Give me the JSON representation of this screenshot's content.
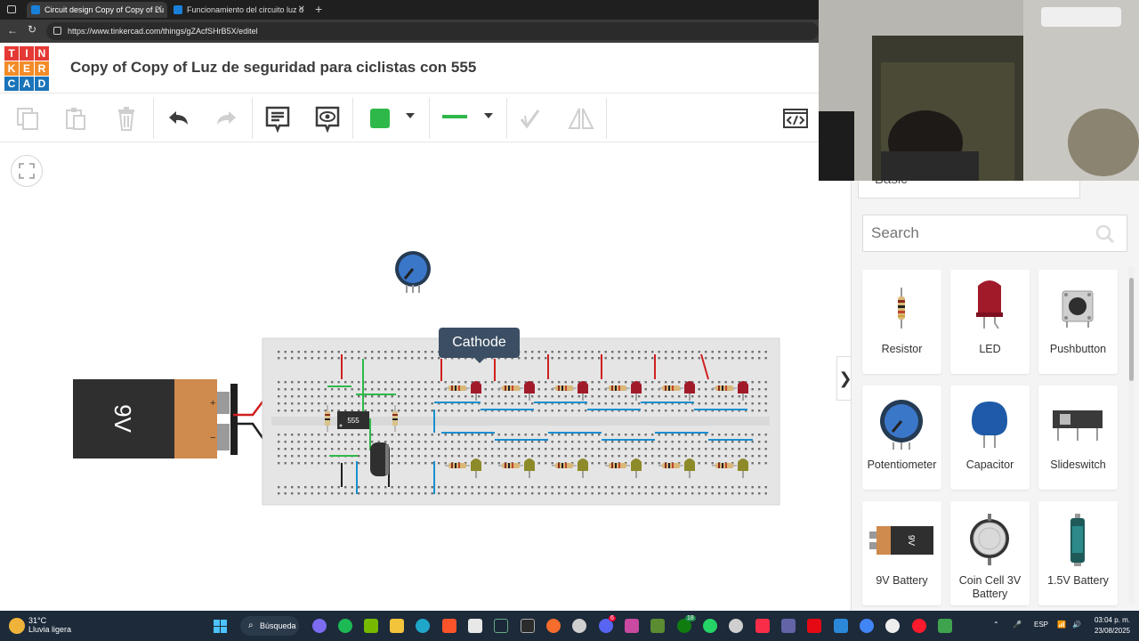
{
  "browser": {
    "tabs": [
      {
        "title": "Circuit design Copy of Copy of Lu"
      },
      {
        "title": "Funcionamiento del circuito luz d"
      }
    ],
    "url": "https://www.tinkercad.com/things/gZAcfSHrB5X/editel"
  },
  "app": {
    "logo_letters": [
      "T",
      "I",
      "N",
      "K",
      "E",
      "R",
      "C",
      "A",
      "D"
    ],
    "title": "Copy of Copy of Luz de seguridad para ciclistas con 555"
  },
  "canvas": {
    "tooltip": "Cathode",
    "battery_label": "9V",
    "ic_label": "555"
  },
  "panel": {
    "category": "Basic",
    "search_placeholder": "Search",
    "components": [
      {
        "label": "Resistor",
        "icon": "resistor-icon"
      },
      {
        "label": "LED",
        "icon": "led-icon"
      },
      {
        "label": "Pushbutton",
        "icon": "pushbutton-icon"
      },
      {
        "label": "Potentiometer",
        "icon": "potentiometer-icon"
      },
      {
        "label": "Capacitor",
        "icon": "capacitor-icon"
      },
      {
        "label": "Slideswitch",
        "icon": "slideswitch-icon"
      },
      {
        "label": "9V Battery",
        "icon": "battery-9v-icon"
      },
      {
        "label": "Coin Cell 3V Battery",
        "icon": "coin-cell-icon"
      },
      {
        "label": "1.5V Battery",
        "icon": "battery-aa-icon"
      }
    ]
  },
  "taskbar": {
    "weather_temp": "31°C",
    "weather_desc": "Lluvia ligera",
    "search_label": "Búsqueda",
    "language": "ESP",
    "time": "03:04 p. m.",
    "date": "23/08/2025",
    "badge_discord": "6",
    "badge_whatsapp": "18"
  },
  "colors": {
    "tinkercad_red": "#e53935",
    "tinkercad_orange": "#f28c28",
    "tinkercad_blue": "#1a74b9",
    "shape_green": "#2fb84a",
    "tooltip_bg": "#3b4e63"
  }
}
